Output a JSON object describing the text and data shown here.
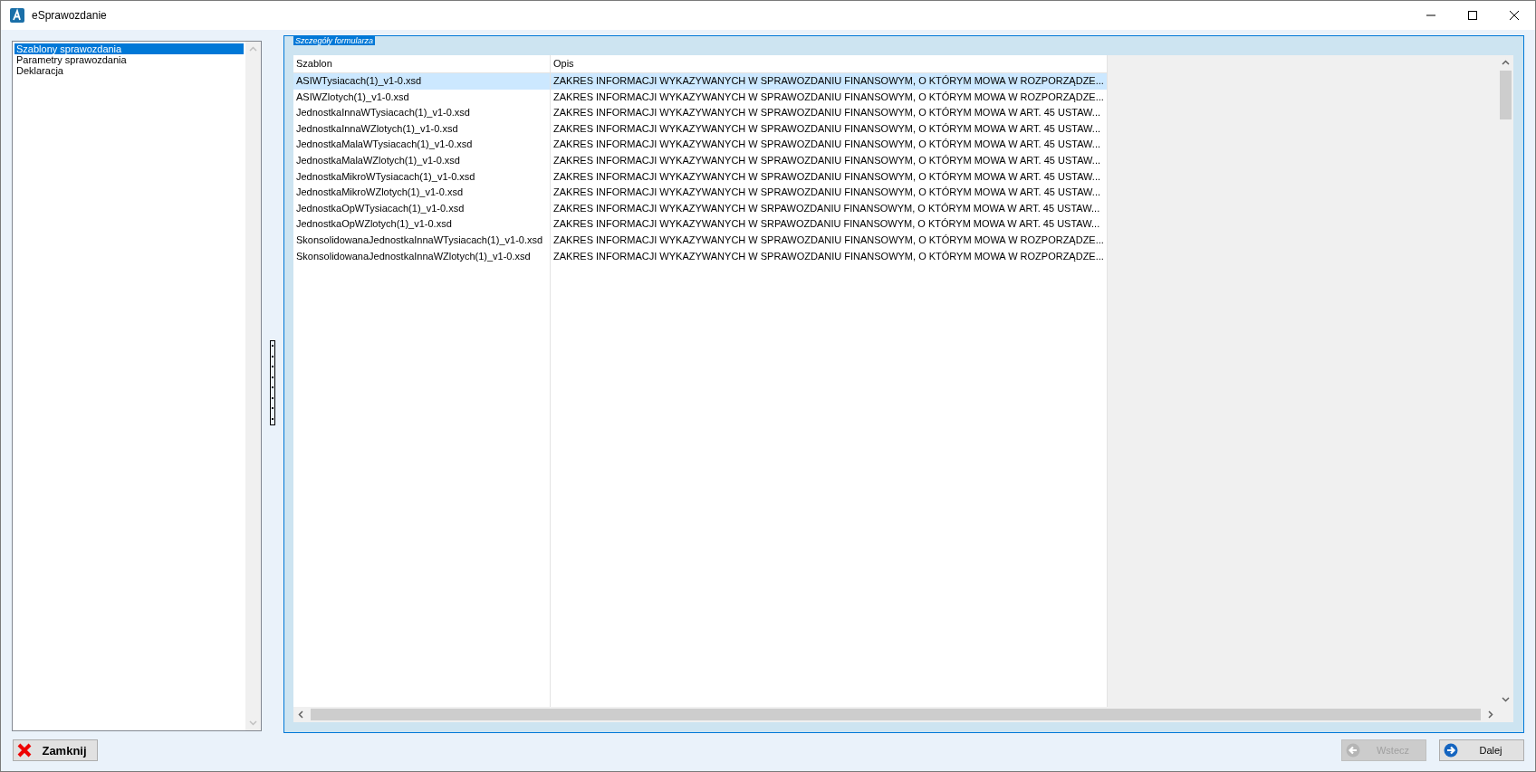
{
  "window": {
    "title": "eSprawozdanie"
  },
  "sidebar": {
    "items": [
      {
        "label": "Szablony sprawozdania",
        "selected": true
      },
      {
        "label": "Parametry sprawozdania",
        "selected": false
      },
      {
        "label": "Deklaracja",
        "selected": false
      }
    ]
  },
  "panel": {
    "title": "Szczegóły formularza"
  },
  "table": {
    "columns": [
      "Szablon",
      "Opis"
    ],
    "rows": [
      {
        "cells": [
          "ASIWTysiacach(1)_v1-0.xsd",
          "ZAKRES INFORMACJI WYKAZYWANYCH W SPRAWOZDANIU FINANSOWYM, O KTÓRYM MOWA W ROZPORZĄDZE..."
        ],
        "selected": true
      },
      {
        "cells": [
          "ASIWZlotych(1)_v1-0.xsd",
          "ZAKRES INFORMACJI WYKAZYWANYCH W SPRAWOZDANIU FINANSOWYM, O KTÓRYM MOWA W ROZPORZĄDZE..."
        ],
        "selected": false
      },
      {
        "cells": [
          "JednostkaInnaWTysiacach(1)_v1-0.xsd",
          "ZAKRES INFORMACJI WYKAZYWANYCH W SPRAWOZDANIU FINANSOWYM, O KTÓRYM MOWA W ART. 45 USTAW..."
        ],
        "selected": false
      },
      {
        "cells": [
          "JednostkaInnaWZlotych(1)_v1-0.xsd",
          "ZAKRES INFORMACJI WYKAZYWANYCH W SPRAWOZDANIU FINANSOWYM, O KTÓRYM MOWA W ART. 45 USTAW..."
        ],
        "selected": false
      },
      {
        "cells": [
          "JednostkaMalaWTysiacach(1)_v1-0.xsd",
          "ZAKRES INFORMACJI WYKAZYWANYCH W SPRAWOZDANIU FINANSOWYM, O KTÓRYM MOWA W ART. 45 USTAW..."
        ],
        "selected": false
      },
      {
        "cells": [
          "JednostkaMalaWZlotych(1)_v1-0.xsd",
          "ZAKRES INFORMACJI WYKAZYWANYCH W SPRAWOZDANIU FINANSOWYM, O KTÓRYM MOWA W ART. 45 USTAW..."
        ],
        "selected": false
      },
      {
        "cells": [
          "JednostkaMikroWTysiacach(1)_v1-0.xsd",
          "ZAKRES INFORMACJI WYKAZYWANYCH W SPRAWOZDANIU FINANSOWYM, O KTÓRYM MOWA W ART. 45 USTAW..."
        ],
        "selected": false
      },
      {
        "cells": [
          "JednostkaMikroWZlotych(1)_v1-0.xsd",
          "ZAKRES INFORMACJI WYKAZYWANYCH W SPRAWOZDANIU FINANSOWYM, O KTÓRYM MOWA W ART. 45 USTAW..."
        ],
        "selected": false
      },
      {
        "cells": [
          "JednostkaOpWTysiacach(1)_v1-0.xsd",
          "ZAKRES INFORMACJI WYKAZYWANYCH W SRPAWOZDANIU FINANSOWYM, O KTÓRYM MOWA W ART. 45 USTAW..."
        ],
        "selected": false
      },
      {
        "cells": [
          "JednostkaOpWZlotych(1)_v1-0.xsd",
          "ZAKRES INFORMACJI WYKAZYWANYCH W SRPAWOZDANIU FINANSOWYM, O KTÓRYM MOWA W ART. 45 USTAW..."
        ],
        "selected": false
      },
      {
        "cells": [
          "SkonsolidowanaJednostkaInnaWTysiacach(1)_v1-0.xsd",
          "ZAKRES INFORMACJI WYKAZYWANYCH W SPRAWOZDANIU FINANSOWYM, O KTÓRYM MOWA W ROZPORZĄDZE..."
        ],
        "selected": false
      },
      {
        "cells": [
          "SkonsolidowanaJednostkaInnaWZlotych(1)_v1-0.xsd",
          "ZAKRES INFORMACJI WYKAZYWANYCH W SPRAWOZDANIU FINANSOWYM, O KTÓRYM MOWA W ROZPORZĄDZE..."
        ],
        "selected": false
      }
    ]
  },
  "buttons": [
    {
      "kind": "close",
      "label": "Zamknij",
      "disabled": false
    },
    {
      "kind": "back",
      "label": "Wstecz",
      "disabled": true
    },
    {
      "kind": "next",
      "label": "Dalej",
      "disabled": false
    }
  ]
}
